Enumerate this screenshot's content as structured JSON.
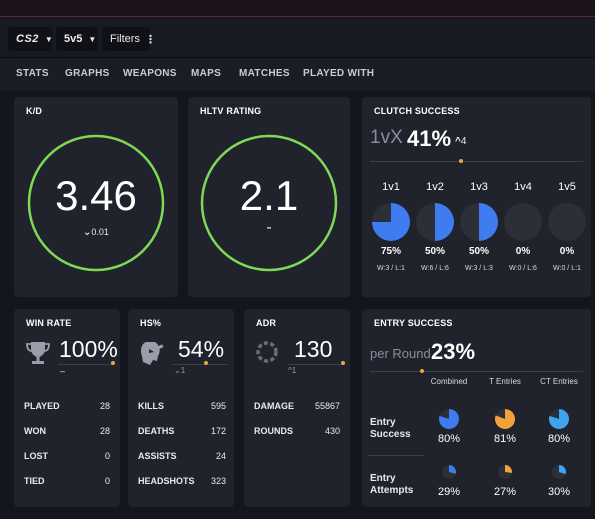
{
  "filters": {
    "game": "CS2",
    "mode": "5v5",
    "filters_label": "Filters"
  },
  "nav": {
    "tabs": [
      "STATS",
      "GRAPHS",
      "WEAPONS",
      "MAPS",
      "MATCHES",
      "PLAYED WITH"
    ]
  },
  "kd": {
    "title": "K/D",
    "value": "3.46",
    "change": "0.01",
    "ring_color": "#7ed957"
  },
  "hltv": {
    "title": "HLTV RATING",
    "value": "2.1",
    "change": "-",
    "ring_color": "#7ed957"
  },
  "clutch": {
    "title": "CLUTCH SUCCESS",
    "prefix": "1vX",
    "percent": "41%",
    "change": "4",
    "columns": [
      {
        "label": "1v1",
        "percent": "75%",
        "fraction": 0.75,
        "record": "W:3 / L:1"
      },
      {
        "label": "1v2",
        "percent": "50%",
        "fraction": 0.5,
        "record": "W:6 / L:6"
      },
      {
        "label": "1v3",
        "percent": "50%",
        "fraction": 0.5,
        "record": "W:3 / L:3"
      },
      {
        "label": "1v4",
        "percent": "0%",
        "fraction": 0,
        "record": "W:0 / L:6"
      },
      {
        "label": "1v5",
        "percent": "0%",
        "fraction": 0,
        "record": "W:0 / L:1"
      }
    ],
    "fill_color": "#3f7cf0"
  },
  "winrate": {
    "title": "WIN RATE",
    "value": "100%",
    "change": "–",
    "icon": "trophy-icon",
    "rows": [
      {
        "label": "PLAYED",
        "value": "28"
      },
      {
        "label": "WON",
        "value": "28"
      },
      {
        "label": "LOST",
        "value": "0"
      },
      {
        "label": "TIED",
        "value": "0"
      }
    ]
  },
  "hs": {
    "title": "HS%",
    "value": "54%",
    "change": "1",
    "icon": "headshot-icon",
    "rows": [
      {
        "label": "KILLS",
        "value": "595"
      },
      {
        "label": "DEATHS",
        "value": "172"
      },
      {
        "label": "ASSISTS",
        "value": "24"
      },
      {
        "label": "HEADSHOTS",
        "value": "323"
      }
    ]
  },
  "adr": {
    "title": "ADR",
    "value": "130",
    "change": "1",
    "icon": "adr-ring-icon",
    "rows": [
      {
        "label": "DAMAGE",
        "value": "55867"
      },
      {
        "label": "ROUNDS",
        "value": "430"
      }
    ]
  },
  "entry": {
    "title": "ENTRY SUCCESS",
    "prefix": "per Round",
    "percent": "23%",
    "col_headers": [
      "Combined",
      "T Entries",
      "CT Entries"
    ],
    "rows": [
      {
        "label_line1": "Entry",
        "label_line2": "Success",
        "cells": [
          {
            "percent": "80%",
            "fraction": 0.8,
            "color": "#3f7cf0"
          },
          {
            "percent": "81%",
            "fraction": 0.81,
            "color": "#f2a13b"
          },
          {
            "percent": "80%",
            "fraction": 0.8,
            "color": "#3fa3f0"
          }
        ]
      },
      {
        "label_line1": "Entry",
        "label_line2": "Attempts",
        "cells": [
          {
            "percent": "29%",
            "fraction": 0.29,
            "color": "#3f7cf0"
          },
          {
            "percent": "27%",
            "fraction": 0.27,
            "color": "#f2a13b"
          },
          {
            "percent": "30%",
            "fraction": 0.3,
            "color": "#3fa3f0"
          }
        ]
      }
    ]
  }
}
